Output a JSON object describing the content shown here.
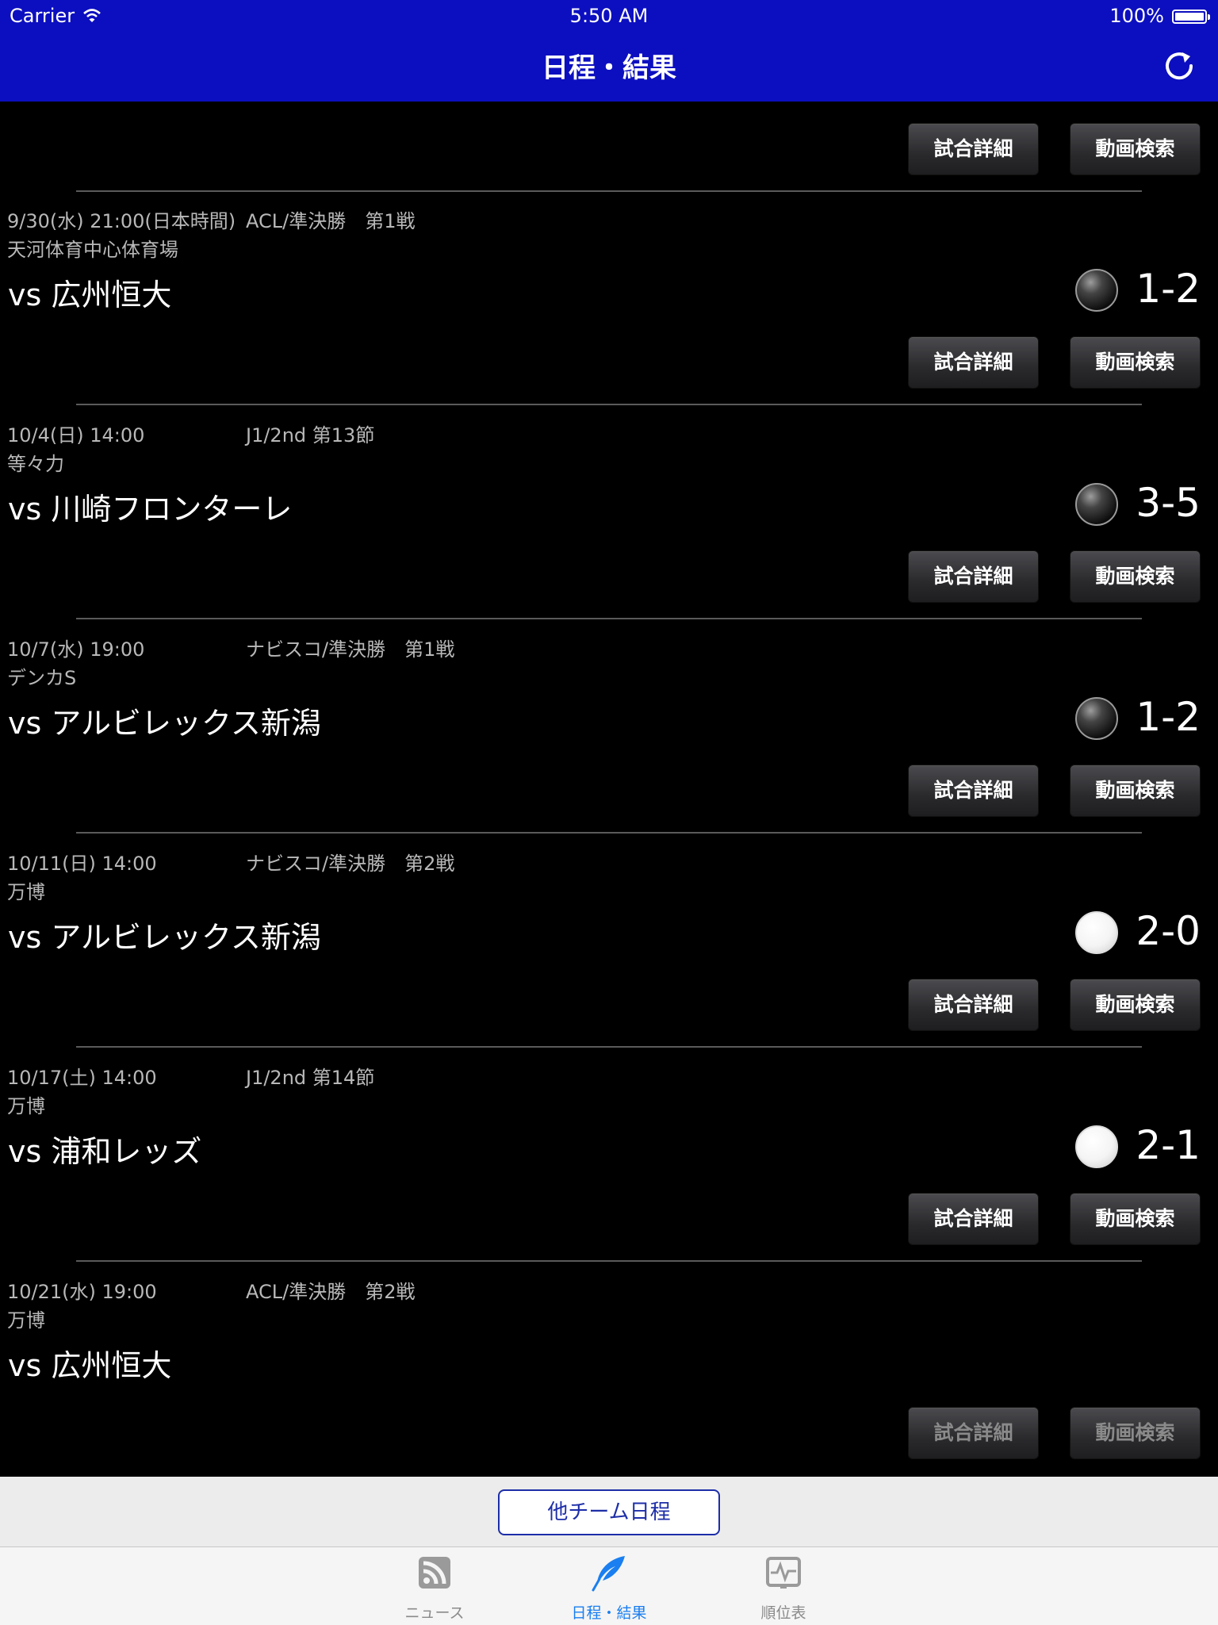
{
  "status_bar": {
    "carrier": "Carrier",
    "time": "5:50 AM",
    "battery": "100%"
  },
  "nav": {
    "title": "日程・結果",
    "refresh_icon": "refresh-icon"
  },
  "buttons": {
    "detail": "試合詳細",
    "video": "動画検索"
  },
  "matches": [
    {
      "datetime": "9/30(水) 21:00(日本時間)",
      "competition": "ACL/準決勝　第1戦",
      "venue": "天河体育中心体育場",
      "opponent": "vs 広州恒大",
      "result": "lose",
      "score": "1-2"
    },
    {
      "datetime": "10/4(日) 14:00",
      "competition": "J1/2nd 第13節",
      "venue": "等々力",
      "opponent": "vs 川崎フロンターレ",
      "result": "lose",
      "score": "3-5"
    },
    {
      "datetime": "10/7(水) 19:00",
      "competition": "ナビスコ/準決勝　第1戦",
      "venue": "デンカS",
      "opponent": "vs アルビレックス新潟",
      "result": "lose",
      "score": "1-2"
    },
    {
      "datetime": "10/11(日) 14:00",
      "competition": "ナビスコ/準決勝　第2戦",
      "venue": "万博",
      "opponent": "vs アルビレックス新潟",
      "result": "win",
      "score": "2-0"
    },
    {
      "datetime": "10/17(土) 14:00",
      "competition": "J1/2nd 第14節",
      "venue": "万博",
      "opponent": "vs 浦和レッズ",
      "result": "win",
      "score": "2-1"
    },
    {
      "datetime": "10/21(水) 19:00",
      "competition": "ACL/準決勝　第2戦",
      "venue": "万博",
      "opponent": "vs 広州恒大",
      "result": "",
      "score": ""
    }
  ],
  "other_button": "他チーム日程",
  "tabs": [
    {
      "label": "ニュース",
      "icon": "rss-icon",
      "active": false
    },
    {
      "label": "日程・結果",
      "icon": "feather-icon",
      "active": true
    },
    {
      "label": "順位表",
      "icon": "chart-icon",
      "active": false
    }
  ]
}
